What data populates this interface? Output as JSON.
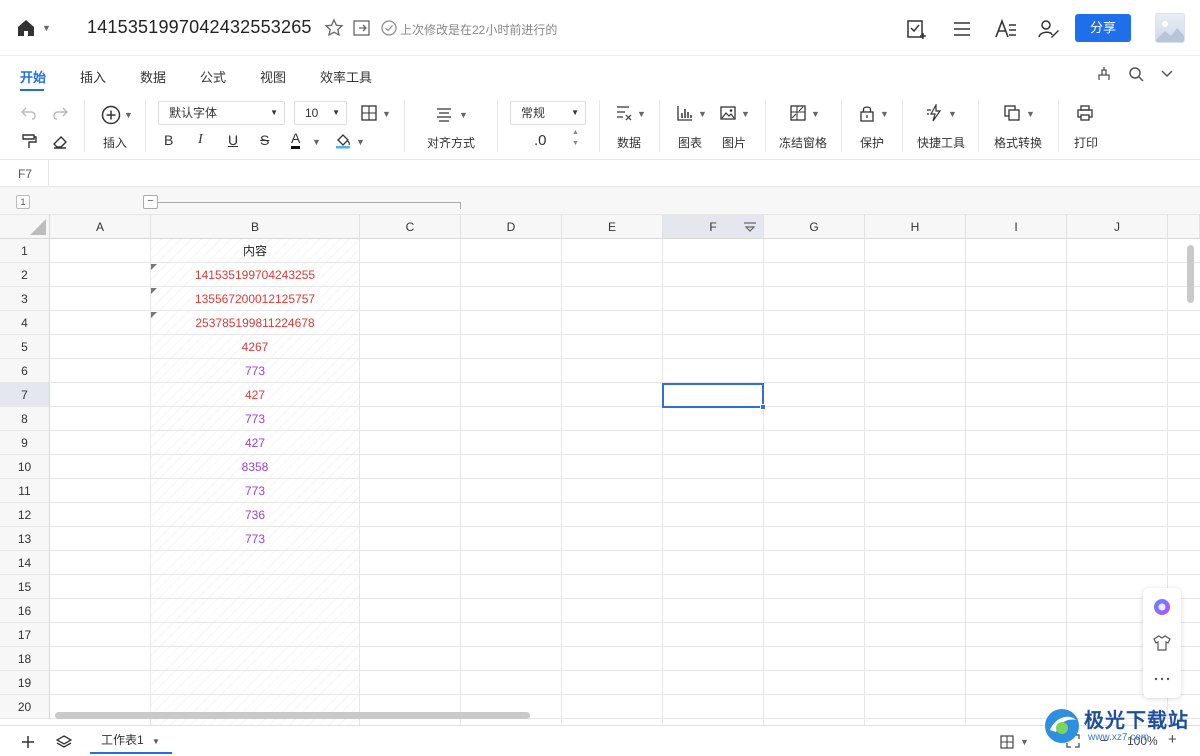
{
  "titlebar": {
    "title": "1415351997042432553265",
    "save_status": "上次修改是在22小时前进行的",
    "share_label": "分享"
  },
  "menu": {
    "tabs": [
      "开始",
      "插入",
      "数据",
      "公式",
      "视图",
      "效率工具"
    ],
    "active": "开始"
  },
  "toolbar": {
    "insert_label": "插入",
    "font_name": "默认字体",
    "font_size": "10",
    "bold": "B",
    "italic": "I",
    "underline": "U",
    "strike": "S",
    "font_color_glyph": "A",
    "align_label": "对齐方式",
    "number_format": "常规",
    "decimal_label": ".0",
    "data_label": "数据",
    "chart_label": "图表",
    "image_label": "图片",
    "freeze_label": "冻结窗格",
    "protect_label": "保护",
    "quick_tools_label": "快捷工具",
    "format_convert_label": "格式转换",
    "print_label": "打印"
  },
  "formula_bar": {
    "cell_ref": "F7"
  },
  "group": {
    "level": "1",
    "collapse": "−"
  },
  "sheet": {
    "columns": [
      "A",
      "B",
      "C",
      "D",
      "E",
      "F",
      "G",
      "H",
      "I",
      "J"
    ],
    "rows": [
      "1",
      "2",
      "3",
      "4",
      "5",
      "6",
      "7",
      "8",
      "9",
      "10",
      "11",
      "12",
      "13",
      "14",
      "15",
      "16",
      "17",
      "18",
      "19",
      "20"
    ],
    "selected_cell": "F7",
    "column_b": [
      {
        "row": "1",
        "value": "内容",
        "color": "#222222"
      },
      {
        "row": "2",
        "value": "141535199704243255",
        "color": "#d93a3a"
      },
      {
        "row": "3",
        "value": "135567200012125757",
        "color": "#d93a3a"
      },
      {
        "row": "4",
        "value": "253785199811224678",
        "color": "#d93a3a"
      },
      {
        "row": "5",
        "value": "4267",
        "color": "#d93a3a"
      },
      {
        "row": "6",
        "value": "773",
        "color": "#9b3fd1"
      },
      {
        "row": "7",
        "value": "427",
        "color": "#d93a3a"
      },
      {
        "row": "8",
        "value": "773",
        "color": "#9b3fd1"
      },
      {
        "row": "9",
        "value": "427",
        "color": "#9b3fd1"
      },
      {
        "row": "10",
        "value": "8358",
        "color": "#9b3fd1"
      },
      {
        "row": "11",
        "value": "773",
        "color": "#9b3fd1"
      },
      {
        "row": "12",
        "value": "736",
        "color": "#9b3fd1"
      },
      {
        "row": "13",
        "value": "773",
        "color": "#9b3fd1"
      }
    ]
  },
  "bottom": {
    "sheet_tab": "工作表1",
    "zoom": "100%"
  },
  "watermark": {
    "text": "极光下载站",
    "url": "www.xz7.com"
  },
  "colors": {
    "accent": "#1f6feb",
    "selection": "#2f6fdc"
  }
}
